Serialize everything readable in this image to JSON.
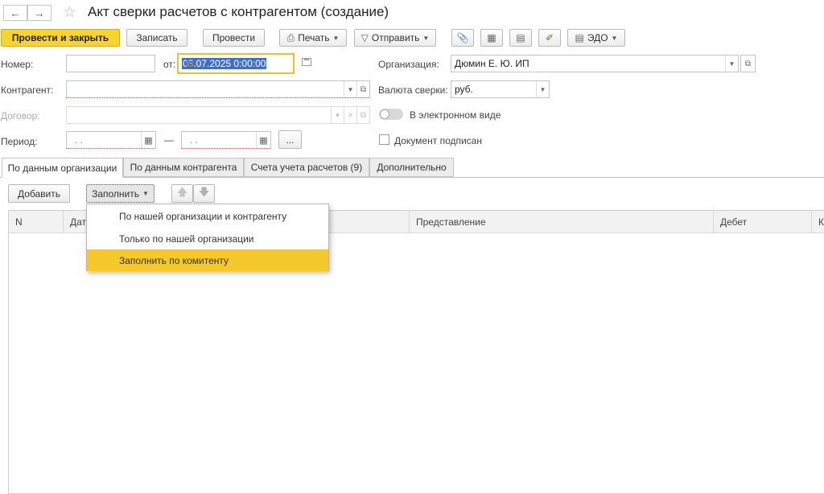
{
  "header": {
    "title": "Акт сверки расчетов с контрагентом (создание)",
    "back_icon": "arrow-left-icon",
    "forward_icon": "arrow-right-icon",
    "favorite_icon": "star-icon"
  },
  "toolbar": {
    "post_close": "Провести и закрыть",
    "save": "Записать",
    "post": "Провести",
    "print": "Печать",
    "send": "Отправить",
    "edo": "ЭДО"
  },
  "form": {
    "number_label": "Номер:",
    "number_value": "",
    "date_label": "от:",
    "date_value": "08.07.2025  0:00:00",
    "counterparty_label": "Контрагент:",
    "counterparty_value": "",
    "contract_label": "Договор:",
    "contract_value": "",
    "period_label": "Период:",
    "period_from": ". .",
    "period_dash": "—",
    "period_to": ". .",
    "period_more": "...",
    "org_label": "Организация:",
    "org_value": "Дюмин Е. Ю. ИП",
    "currency_label": "Валюта сверки:",
    "currency_value": "руб.",
    "electronic_label": "В электронном виде",
    "signed_label": "Документ подписан"
  },
  "tabs": [
    {
      "label": "По данным организации"
    },
    {
      "label": "По данным контрагента"
    },
    {
      "label": "Счета учета расчетов (9)"
    },
    {
      "label": "Дополнительно"
    }
  ],
  "table_toolbar": {
    "add": "Добавить",
    "fill": "Заполнить"
  },
  "table": {
    "columns": [
      "N",
      "Дата",
      "Представление",
      "Дебет",
      "К"
    ]
  },
  "fill_menu": {
    "items": [
      "По нашей организации и контрагенту",
      "Только по нашей организации",
      "Заполнить по комитенту"
    ],
    "highlighted_index": 2
  },
  "colors": {
    "primary_button": "#f7d42f",
    "menu_highlight": "#f5c92b",
    "date_focus_border": "#e8c22a"
  }
}
